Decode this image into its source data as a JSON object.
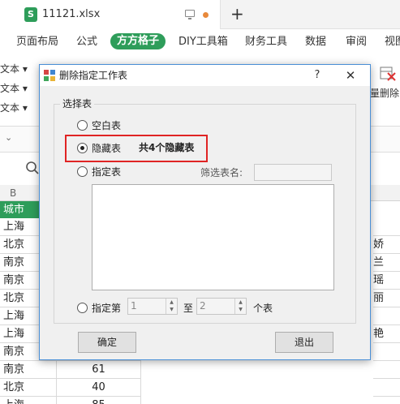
{
  "tabbar": {
    "filename": "11121.xlsx",
    "app_icon_letter": "S",
    "new_tab": "+"
  },
  "menu": [
    "页面布局",
    "公式",
    "方方格子",
    "DIY工具箱",
    "财务工具",
    "数据",
    "审阅",
    "视图"
  ],
  "toolbar": {
    "left_items": [
      "▾文本 ▾",
      "▾文本 ▾",
      "▾文本 ▾"
    ],
    "right_label": "量删除"
  },
  "formula_bar": {
    "chevron": "⌄"
  },
  "sheet": {
    "column_header": "B",
    "header": "城市",
    "cities": [
      "上海",
      "北京",
      "南京",
      "南京",
      "北京",
      "上海",
      "上海",
      "南京",
      "南京",
      "北京",
      "上海"
    ],
    "values": [
      "",
      "",
      "",
      "",
      "",
      "",
      "",
      "",
      "61",
      "40",
      "85"
    ],
    "right_names": [
      "",
      "娇",
      "兰",
      "瑶",
      "丽",
      "",
      "艳",
      "",
      "",
      "",
      ""
    ]
  },
  "dialog": {
    "title": "删除指定工作表",
    "help": "?",
    "close": "✕",
    "group_label": "选择表",
    "options": {
      "blank": "空白表",
      "hidden": "隐藏表",
      "specified": "指定表",
      "range": "指定第"
    },
    "selected_option": "hidden",
    "hidden_count_text": "共4个隐藏表",
    "filter_label": "筛选表名:",
    "range_from": "1",
    "range_to": "2",
    "range_mid": "至",
    "range_suffix": "个表",
    "ok_button": "确定",
    "exit_button": "退出"
  },
  "colors": {
    "accent_green": "#2e9d5a",
    "highlight_red": "#e02424",
    "dialog_border": "#4a8fd6"
  }
}
